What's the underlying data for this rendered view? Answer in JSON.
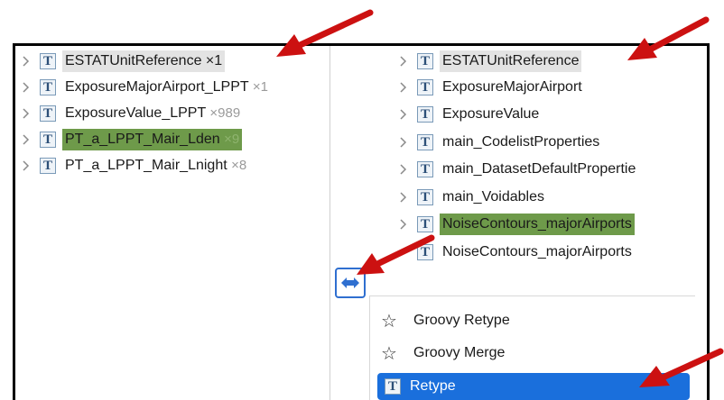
{
  "left_tree": [
    {
      "label": "ESTATUnitReference",
      "count": "×1",
      "state": "selected-gray"
    },
    {
      "label": "ExposureMajorAirport_LPPT",
      "count": "×1",
      "state": "normal"
    },
    {
      "label": "ExposureValue_LPPT",
      "count": "×989",
      "state": "normal"
    },
    {
      "label": "PT_a_LPPT_Mair_Lden",
      "count": "×9",
      "state": "selected-green"
    },
    {
      "label": "PT_a_LPPT_Mair_Lnight",
      "count": "×8",
      "state": "normal"
    }
  ],
  "right_tree": [
    {
      "label": "ESTATUnitReference",
      "state": "selected-gray",
      "expandable": true
    },
    {
      "label": "ExposureMajorAirport",
      "state": "normal",
      "expandable": true
    },
    {
      "label": "ExposureValue",
      "state": "normal",
      "expandable": true
    },
    {
      "label": "main_CodelistProperties",
      "state": "normal",
      "expandable": true
    },
    {
      "label": "main_DatasetDefaultPropertie",
      "state": "normal",
      "expandable": true
    },
    {
      "label": "main_Voidables",
      "state": "normal",
      "expandable": true
    },
    {
      "label": "NoiseContours_majorAirports",
      "state": "selected-green",
      "expandable": true
    },
    {
      "label": "NoiseContours_majorAirports",
      "state": "normal",
      "expandable": false
    }
  ],
  "menu": {
    "items": [
      {
        "label": "Groovy Retype",
        "icon": "star-icon"
      },
      {
        "label": "Groovy Merge",
        "icon": "star-icon"
      },
      {
        "label": "Retype",
        "icon": "type-t-icon",
        "active": true
      }
    ]
  },
  "icons": {
    "type_letter": "T",
    "chevron": "chevron-right-icon",
    "mapping": "double-arrow-icon"
  },
  "colors": {
    "selection_green": "#6e9a4a",
    "selection_gray": "#e3e3e3",
    "menu_active": "#1a6fdc",
    "annotation_red": "#cc1111"
  }
}
